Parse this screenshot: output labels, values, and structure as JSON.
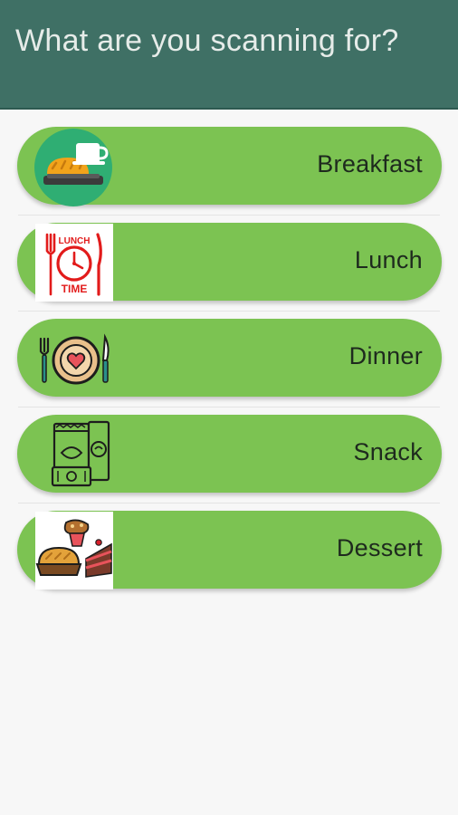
{
  "header": {
    "title": "What are you scanning for?",
    "background_color": "#3f7065"
  },
  "accent_color": "#7cc352",
  "options": [
    {
      "label": "Breakfast",
      "icon": "breakfast-icon"
    },
    {
      "label": "Lunch",
      "icon": "lunch-time-icon",
      "icon_text": [
        "LUNCH",
        "TIME"
      ]
    },
    {
      "label": "Dinner",
      "icon": "dinner-plate-icon"
    },
    {
      "label": "Snack",
      "icon": "snack-packs-icon"
    },
    {
      "label": "Dessert",
      "icon": "dessert-icon"
    }
  ]
}
